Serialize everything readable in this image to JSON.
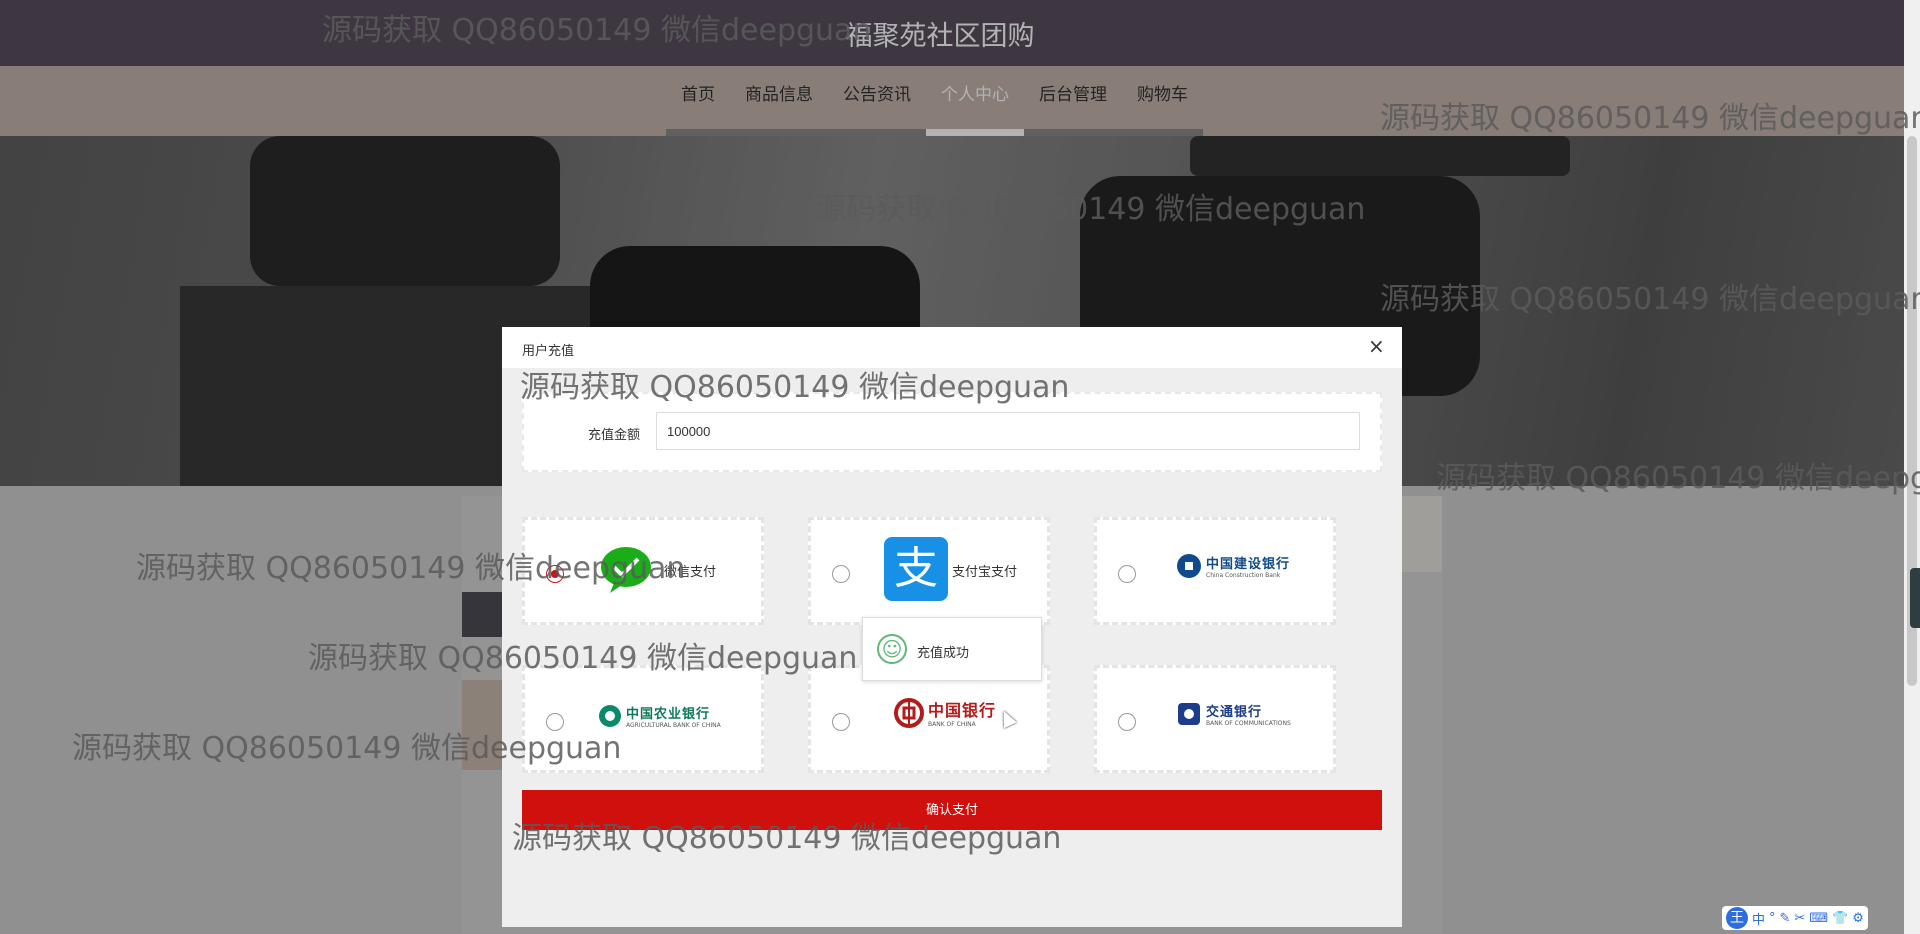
{
  "site": {
    "title": "福聚苑社区团购"
  },
  "nav": {
    "items": [
      {
        "label": "首页",
        "active": false
      },
      {
        "label": "商品信息",
        "active": false
      },
      {
        "label": "公告资讯",
        "active": false
      },
      {
        "label": "个人中心",
        "active": true
      },
      {
        "label": "后台管理",
        "active": false
      },
      {
        "label": "购物车",
        "active": false
      }
    ]
  },
  "modal": {
    "title": "用户充值",
    "close_icon": "close-icon",
    "amount_label": "充值金额",
    "amount_value": "100000",
    "payments": [
      {
        "label": "微信支付",
        "icon": "wechat-pay-icon",
        "checked": true
      },
      {
        "label": "支付宝支付",
        "icon": "alipay-icon",
        "checked": false
      },
      {
        "bank": "中国建设银行",
        "sub": "China Construction Bank",
        "icon": "ccb-logo-icon",
        "checked": false
      },
      {
        "bank": "中国农业银行",
        "sub": "AGRICULTURAL BANK OF CHINA",
        "icon": "abc-logo-icon",
        "checked": false
      },
      {
        "bank": "中国银行",
        "sub": "BANK OF CHINA",
        "icon": "boc-logo-icon",
        "checked": false
      },
      {
        "bank": "交通银行",
        "sub": "BANK OF COMMUNICATIONS",
        "icon": "bocom-logo-icon",
        "checked": false
      }
    ],
    "confirm_label": "确认支付"
  },
  "toast": {
    "text": "充值成功",
    "icon": "smile-icon"
  },
  "watermark": "源码获取 QQ86050149 微信deepguan",
  "ime": {
    "logo": "王",
    "mode": "中",
    "items": [
      "°",
      "✎",
      "✂",
      "⌨",
      "👕",
      "⚙"
    ]
  },
  "colors": {
    "header": "#59505f",
    "nav": "#c3b4ab",
    "accent_red": "#d0100c",
    "alipay_blue": "#1890e6",
    "wechat_green": "#1aad19"
  }
}
